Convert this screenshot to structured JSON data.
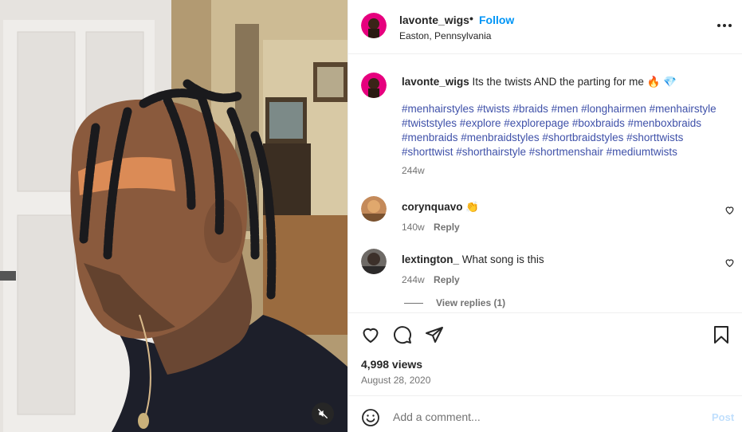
{
  "post": {
    "username": "lavonte_wigs",
    "separator": "•",
    "follow_label": "Follow",
    "location": "Easton, Pennsylvania",
    "caption_text": "Its the twists AND the parting for me 🔥 💎",
    "hashtags": "#menhairstyles #twists #braids #men #longhairmen #menhairstyle #twiststyles #explore #explorepage #boxbraids #menboxbraids #menbraids #menbraidstyles #shortbraidstyles #shorttwists #shorttwist #shorthairstyle #shortmenshair #mediumtwists",
    "caption_time": "244w",
    "views": "4,998 views",
    "date": "August 28, 2020"
  },
  "comments": [
    {
      "username": "corynquavo",
      "text": "👏",
      "time": "140w",
      "reply_label": "Reply"
    },
    {
      "username": "lextington_",
      "text": "What song is this",
      "time": "244w",
      "reply_label": "Reply"
    }
  ],
  "view_replies_label": "View replies (1)",
  "composer": {
    "placeholder": "Add a comment...",
    "post_label": "Post"
  },
  "icons": [
    "more-icon",
    "heart-icon",
    "comment-icon",
    "share-icon",
    "bookmark-icon",
    "emoji-icon",
    "mute-icon"
  ],
  "colors": {
    "link": "#0095f6",
    "hashtag": "#3f51a9",
    "muted": "#737373",
    "post_disabled": "#c0dffd"
  }
}
